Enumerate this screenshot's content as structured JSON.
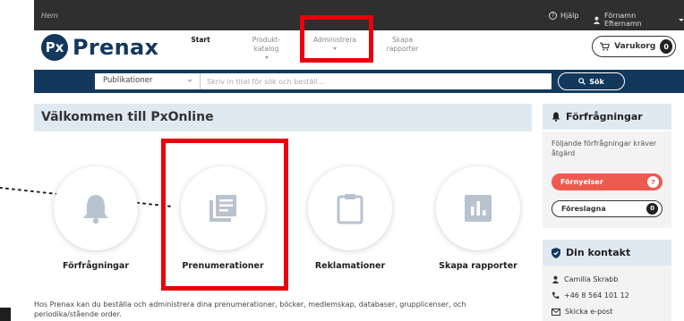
{
  "topbar": {
    "home": "Hem",
    "help": "Hjälp",
    "user": "Förnamn Efternamn"
  },
  "brand": {
    "mark": "Px",
    "name": "Prenax"
  },
  "nav": [
    {
      "line1": "Start",
      "line2": ""
    },
    {
      "line1": "Produkt-",
      "line2": "katalog"
    },
    {
      "line1": "Administrera",
      "line2": ""
    },
    {
      "line1": "Skapa",
      "line2": "rapporter"
    }
  ],
  "cart": {
    "label": "Varukorg",
    "count": "0"
  },
  "search": {
    "scope": "Publikationer",
    "placeholder": "Skriv in titel för sök och beställ...",
    "button": "Sök"
  },
  "welcome": "Välkommen till PxOnline",
  "tiles": [
    {
      "label": "Förfrågningar",
      "icon": "bell-icon"
    },
    {
      "label": "Prenumerationer",
      "icon": "newspaper-icon"
    },
    {
      "label": "Reklamationer",
      "icon": "clipboard-icon"
    },
    {
      "label": "Skapa rapporter",
      "icon": "bar-chart-icon"
    }
  ],
  "intro": "Hos Prenax kan du beställa och administrera dina prenumerationer, böcker, medlemskap, databaser, grupplicenser, och periodika/stående order.",
  "requests": {
    "title": "Förfrågningar",
    "text": "Följande förfrågningar kräver åtgärd",
    "renewals_label": "Förnyelser",
    "renewals_count": "7",
    "suggested_label": "Föreslagna",
    "suggested_count": "0"
  },
  "contact": {
    "title": "Din kontakt",
    "name": "Camilla Skrabb",
    "phone": "+46 8 564 101 12",
    "email": "Skicka e-post"
  },
  "colors": {
    "brand": "#13385c",
    "highlight": "#e8000b",
    "accent_light": "#dfe9f2",
    "renewals": "#ee5a4f"
  }
}
